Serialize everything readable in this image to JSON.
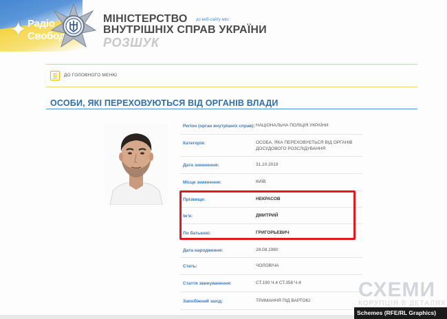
{
  "header": {
    "ministry_line1": "МІНІСТЕРСТВО",
    "ministry_line2": "ВНУТРІШНІХ СПРАВ УКРАЇНИ",
    "subtitle": "РОЗШУК",
    "site_link": "до веб-сайту мвс",
    "radio_logo_line1": "Радіо",
    "radio_logo_line2": "Свобода"
  },
  "menu": {
    "home_label": "ДО ГОЛОВНОГО МЕНЮ"
  },
  "section": {
    "title": "ОСОБИ, ЯКІ ПЕРЕХОВУЮТЬСЯ ВІД ОРГАНІВ ВЛАДИ"
  },
  "fields": [
    {
      "label": "Регіон (орган внутрішніх справ):",
      "value": "НАЦІОНАЛЬНА ПОЛІЦІЯ УКРАЇНИ"
    },
    {
      "label": "Категорія:",
      "value": "ОСОБА, ЯКА ПЕРЕХОВУЄТЬСЯ ВІД ОРГАНІВ",
      "value2": "ДОСУДОВОГО РОЗСЛІДУВАННЯ"
    },
    {
      "label": "Дата зникнення:",
      "value": "31.10.2019"
    },
    {
      "label": "Місце зникнення:",
      "value": "КИЇВ"
    },
    {
      "label": "Прізвище:",
      "value": "НЕКРАСОВ"
    },
    {
      "label": "Ім'я:",
      "value": "ДМИТРИЙ"
    },
    {
      "label": "По батькові:",
      "value": "ГРИГОРЬЕВИЧ"
    },
    {
      "label": "Дата народження:",
      "value": "28.08.1980"
    },
    {
      "label": "Стать:",
      "value": "ЧОЛОВІЧА"
    },
    {
      "label": "Стаття звинувачення:",
      "value": "СТ.190 Ч.4 СТ.358 Ч.4"
    },
    {
      "label": "Запобіжний захід:",
      "value": "ТРИМАННЯ ПІД ВАРТОЮ"
    }
  ],
  "watermark": {
    "brand": "СХЕМИ",
    "tagline": "КОРУПЦІЯ В ДЕТАЛЯХ",
    "credit": "Schemes (RFE/RL Graphics)"
  },
  "colors": {
    "accent_blue": "#2f6ea8",
    "highlight_red": "#e4161f",
    "menu_gold": "#f0b400"
  }
}
